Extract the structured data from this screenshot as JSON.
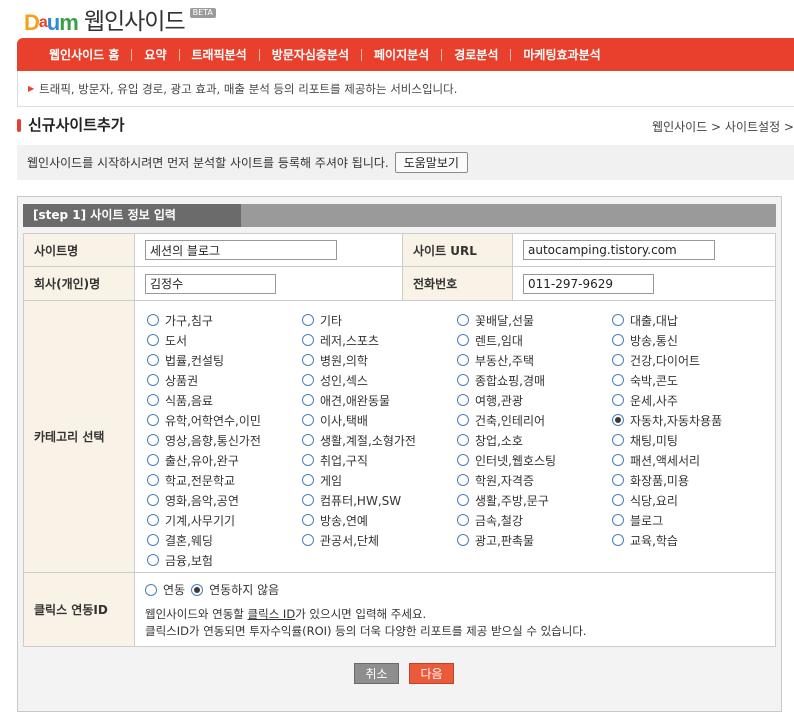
{
  "header": {
    "logo_letters": [
      "D",
      "a",
      "u",
      "m"
    ],
    "app_title": "웹인사이드",
    "beta_badge": "BETA"
  },
  "nav": {
    "items": [
      {
        "label": "웹인사이드 홈"
      },
      {
        "label": "요약"
      },
      {
        "label": "트래픽분석"
      },
      {
        "label": "방문자심층분석"
      },
      {
        "label": "페이지분석"
      },
      {
        "label": "경로분석"
      },
      {
        "label": "마케팅효과분석"
      }
    ],
    "description": "트래픽, 방문자, 유입 경로, 광고 효과, 매출 분석 등의 리포트를 제공하는 서비스입니다."
  },
  "page": {
    "title": "신규사이트추가",
    "breadcrumb": "웹인사이드 > 사이트설정 >",
    "intro_text": "웹인사이드를 시작하시려면 먼저 분석할 사이트를 등록해 주셔야 됩니다.",
    "help_button": "도움말보기"
  },
  "form": {
    "step_label": "[step 1] 사이트 정보 입력",
    "site_name_label": "사이트명",
    "site_name_value": "세션의 블로그",
    "site_url_label": "사이트 URL",
    "site_url_value": "autocamping.tistory.com",
    "company_label": "회사(개인)명",
    "company_value": "김정수",
    "phone_label": "전화번호",
    "phone_value": "011-297-9629",
    "category_label": "카테고리 선택",
    "categories": [
      {
        "label": "가구,침구",
        "selected": false
      },
      {
        "label": "기타",
        "selected": false
      },
      {
        "label": "꽃배달,선물",
        "selected": false
      },
      {
        "label": "대출,대납",
        "selected": false
      },
      {
        "label": "도서",
        "selected": false
      },
      {
        "label": "레저,스포츠",
        "selected": false
      },
      {
        "label": "렌트,임대",
        "selected": false
      },
      {
        "label": "방송,통신",
        "selected": false
      },
      {
        "label": "법률,컨설팅",
        "selected": false
      },
      {
        "label": "병원,의학",
        "selected": false
      },
      {
        "label": "부동산,주택",
        "selected": false
      },
      {
        "label": "건강,다이어트",
        "selected": false
      },
      {
        "label": "상품권",
        "selected": false
      },
      {
        "label": "성인,섹스",
        "selected": false
      },
      {
        "label": "종합쇼핑,경매",
        "selected": false
      },
      {
        "label": "숙박,콘도",
        "selected": false
      },
      {
        "label": "식품,음료",
        "selected": false
      },
      {
        "label": "애견,애완동물",
        "selected": false
      },
      {
        "label": "여행,관광",
        "selected": false
      },
      {
        "label": "운세,사주",
        "selected": false
      },
      {
        "label": "유학,어학연수,이민",
        "selected": false
      },
      {
        "label": "이사,택배",
        "selected": false
      },
      {
        "label": "건축,인테리어",
        "selected": false
      },
      {
        "label": "자동차,자동차용품",
        "selected": true
      },
      {
        "label": "영상,음향,통신가전",
        "selected": false
      },
      {
        "label": "생활,계절,소형가전",
        "selected": false
      },
      {
        "label": "창업,소호",
        "selected": false
      },
      {
        "label": "채팅,미팅",
        "selected": false
      },
      {
        "label": "출산,유아,완구",
        "selected": false
      },
      {
        "label": "취업,구직",
        "selected": false
      },
      {
        "label": "인터넷,웹호스팅",
        "selected": false
      },
      {
        "label": "패션,액세서리",
        "selected": false
      },
      {
        "label": "학교,전문학교",
        "selected": false
      },
      {
        "label": "게임",
        "selected": false
      },
      {
        "label": "학원,자격증",
        "selected": false
      },
      {
        "label": "화장품,미용",
        "selected": false
      },
      {
        "label": "영화,음악,공연",
        "selected": false
      },
      {
        "label": "컴퓨터,HW,SW",
        "selected": false
      },
      {
        "label": "생활,주방,문구",
        "selected": false
      },
      {
        "label": "식당,요리",
        "selected": false
      },
      {
        "label": "기계,사무기기",
        "selected": false
      },
      {
        "label": "방송,연예",
        "selected": false
      },
      {
        "label": "금속,철강",
        "selected": false
      },
      {
        "label": "블로그",
        "selected": false
      },
      {
        "label": "결혼,웨딩",
        "selected": false
      },
      {
        "label": "관공서,단체",
        "selected": false
      },
      {
        "label": "광고,판촉물",
        "selected": false
      },
      {
        "label": "교육,학습",
        "selected": false
      },
      {
        "label": "금융,보험",
        "selected": false
      }
    ],
    "clix_label": "클릭스 연동ID",
    "clix_link_option": "연동",
    "clix_nolink_option": "연동하지 않음",
    "clix_note_1_pre": "웹인사이드와 연동할 ",
    "clix_note_1_u": "클릭스 ID",
    "clix_note_1_post": "가 있으시면 입력해 주세요.",
    "clix_note_2": "클릭스ID가 연동되면 투자수익률(ROI) 등의 더욱 다양한 리포트를 제공 받으실 수 있습니다.",
    "cancel_button": "취소",
    "next_button": "다음"
  },
  "colors": {
    "brand_red": "#e8402d",
    "header_cell": "#f8f3e6",
    "step_dark": "#6b6b6b",
    "step_light": "#9a9a9a"
  }
}
